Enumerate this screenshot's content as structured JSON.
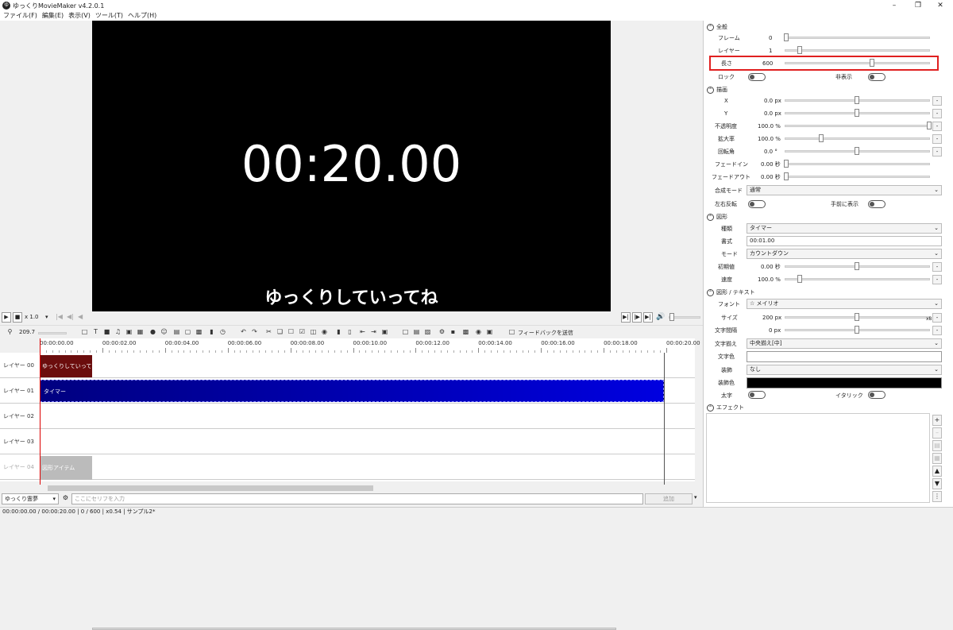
{
  "window": {
    "title": "ゆっくりMovieMaker v4.2.0.1",
    "app_icon": "ゆ"
  },
  "menu": [
    "ファイル(F)",
    "編集(E)",
    "表示(V)",
    "ツール(T)",
    "ヘルプ(H)"
  ],
  "preview": {
    "timer": "00:20.00",
    "subtitle": "ゆっくりしていってね"
  },
  "transport": {
    "speed": "x 1.0"
  },
  "toolbar": {
    "zoom": "209.7",
    "feedback": "フィードバックを送信"
  },
  "ruler": {
    "labels": [
      "00:00:00.00",
      "00:00:02.00",
      "00:00:04.00",
      "00:00:06.00",
      "00:00:08.00",
      "00:00:10.00",
      "00:00:12.00",
      "00:00:14.00",
      "00:00:16.00",
      "00:00:18.00",
      "00:00:20.00"
    ]
  },
  "layers": [
    "レイヤー 00",
    "レイヤー 01",
    "レイヤー 02",
    "レイヤー 03",
    "レイヤー 04"
  ],
  "clips": {
    "yukkuri": "ゆっくりしていってね",
    "timer": "タイマー",
    "shape": "図形アイテム"
  },
  "input": {
    "character": "ゆっくり霊夢",
    "placeholder": "ここにセリフを入力",
    "add": "追加"
  },
  "status": {
    "text": "00:00:00.00  /  00:00:20.00  |  0  /  600  |  x0.54  |  サンプル2*"
  },
  "panel": {
    "general": {
      "title": "全般",
      "frame_label": "フレーム",
      "frame_value": "0",
      "layer_label": "レイヤー",
      "layer_value": "1",
      "length_label": "長さ",
      "length_value": "600",
      "lock_label": "ロック",
      "hide_label": "非表示"
    },
    "draw": {
      "title": "描画",
      "x_label": "X",
      "x_value": "0.0 px",
      "y_label": "Y",
      "y_value": "0.0 px",
      "opacity_label": "不透明度",
      "opacity_value": "100.0 %",
      "scale_label": "拡大率",
      "scale_value": "100.0 %",
      "rotation_label": "回転角",
      "rotation_value": "0.0 °",
      "fadein_label": "フェードイン",
      "fadein_value": "0.00 秒",
      "fadeout_label": "フェードアウト",
      "fadeout_value": "0.00 秒",
      "blend_label": "合成モード",
      "blend_value": "通常",
      "flip_label": "左右反転",
      "front_label": "手前に表示"
    },
    "shape": {
      "title": "図形",
      "kind_label": "種類",
      "kind_value": "タイマー",
      "format_label": "書式",
      "format_value": "00:01.00",
      "mode_label": "モード",
      "mode_value": "カウントダウン",
      "initial_label": "初期値",
      "initial_value": "0.00 秒",
      "speed_label": "速度",
      "speed_value": "100.0 %"
    },
    "text": {
      "title": "図形 / テキスト",
      "font_label": "フォント",
      "font_value": "メイリオ",
      "size_label": "サイズ",
      "size_value": "200 px",
      "spacing_label": "文字間隔",
      "spacing_value": "0 px",
      "align_label": "文字揃え",
      "align_value": "中央揃え[中]",
      "color_label": "文字色",
      "deco_label": "装飾",
      "deco_value": "なし",
      "decocolor_label": "装飾色",
      "bold_label": "太字",
      "italic_label": "イタリック",
      "x8": "x8"
    },
    "effect": {
      "title": "エフェクト"
    }
  },
  "colors": {
    "accent_highlight": "#e02020",
    "clip_blue": "#0000c0",
    "clip_red": "#6b0d0d",
    "text_color": "#ffffff",
    "deco_color": "#000000"
  }
}
